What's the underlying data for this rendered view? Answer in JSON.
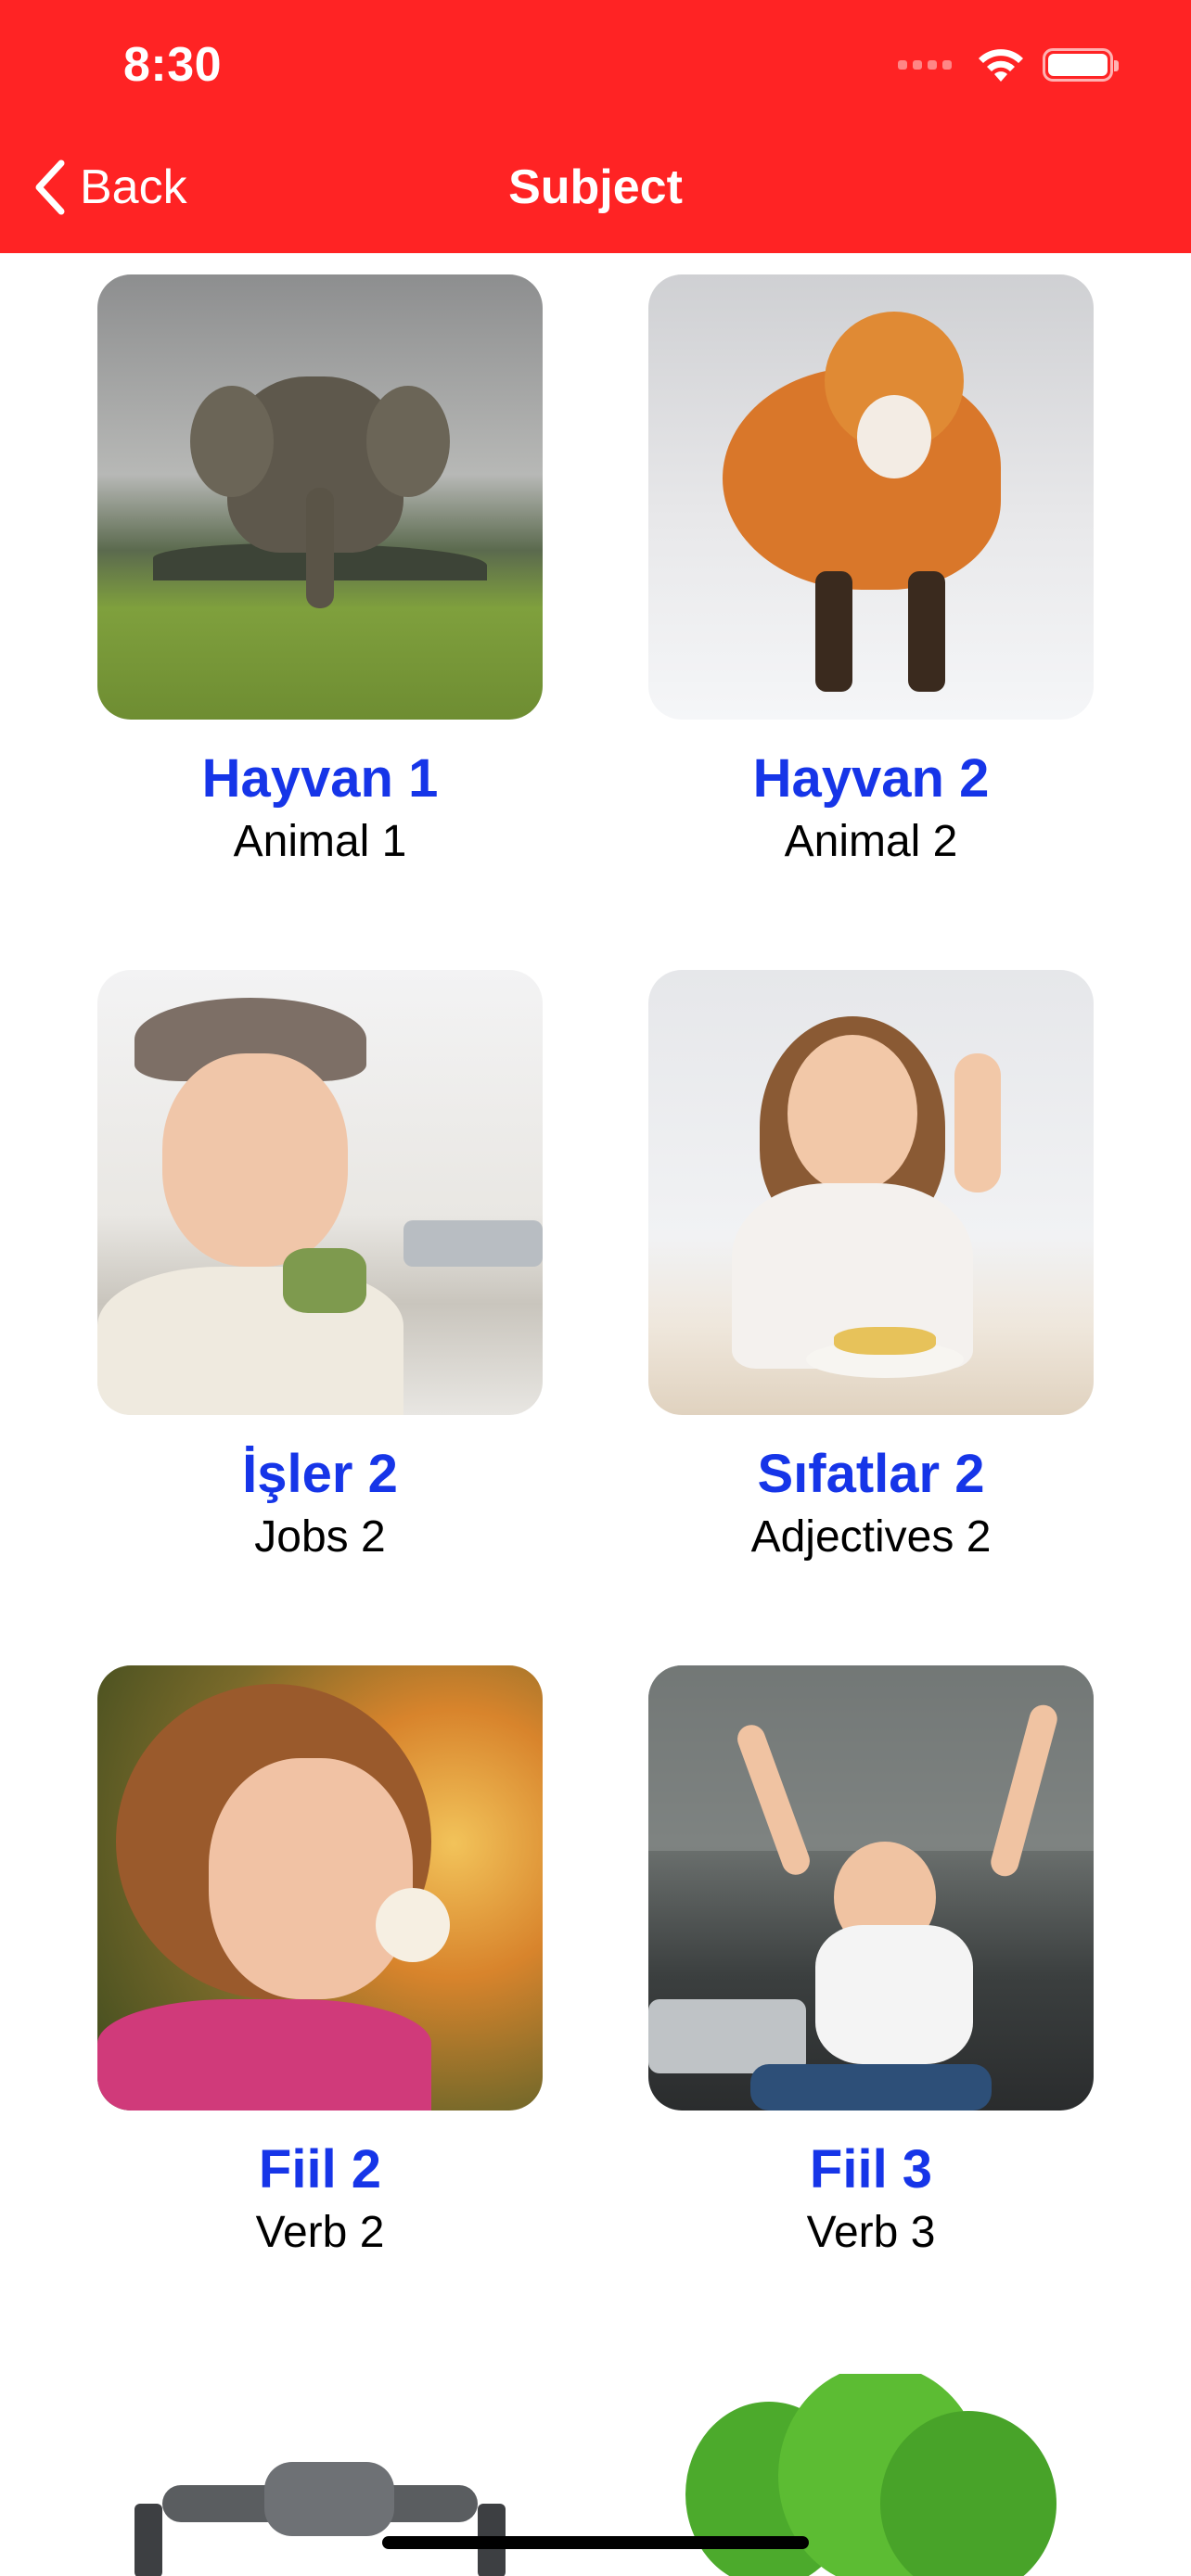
{
  "status_bar": {
    "time": "8:30"
  },
  "nav": {
    "back_label": "Back",
    "title": "Subject"
  },
  "colors": {
    "header_bg": "#ff2324",
    "title_blue": "#1635e8"
  },
  "subjects": [
    {
      "title": "Hayvan 1",
      "subtitle": "Animal 1",
      "image": "elephant"
    },
    {
      "title": "Hayvan 2",
      "subtitle": "Animal 2",
      "image": "fox"
    },
    {
      "title": "İşler 2",
      "subtitle": "Jobs 2",
      "image": "flight-attendant"
    },
    {
      "title": "Sıfatlar 2",
      "subtitle": "Adjectives 2",
      "image": "girl-thumbs-up"
    },
    {
      "title": "Fiil 2",
      "subtitle": "Verb 2",
      "image": "girl-dandelion"
    },
    {
      "title": "Fiil 3",
      "subtitle": "Verb 3",
      "image": "woman-stretching"
    }
  ],
  "partial_row": [
    {
      "image": "drone"
    },
    {
      "image": "lettuce"
    }
  ]
}
